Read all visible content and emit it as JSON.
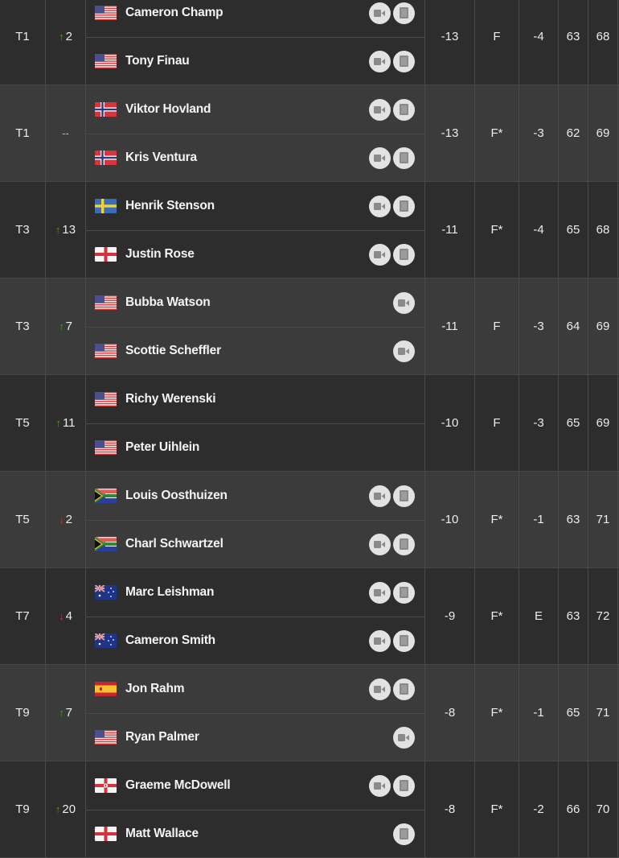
{
  "colors": {
    "row_dark": "#2d2d2d",
    "row_light": "#3b3b3b",
    "move_up": "#4c9a2a",
    "move_down": "#e0322a",
    "icon_bg": "#e2e2e2",
    "icon_glyph": "#8a8a8a"
  },
  "teams": [
    {
      "pos": "T1",
      "move": {
        "dir": "up",
        "value": "2"
      },
      "total": "-13",
      "thru": "F",
      "today": "-4",
      "r1": "63",
      "r2": "68",
      "players": [
        {
          "name": "Cameron Champ",
          "flag": "usa",
          "icons": [
            "video-icon",
            "scorecard-icon"
          ]
        },
        {
          "name": "Tony Finau",
          "flag": "usa",
          "icons": [
            "video-icon",
            "scorecard-icon"
          ]
        }
      ]
    },
    {
      "pos": "T1",
      "move": {
        "dir": "none",
        "value": "--"
      },
      "total": "-13",
      "thru": "F*",
      "today": "-3",
      "r1": "62",
      "r2": "69",
      "players": [
        {
          "name": "Viktor Hovland",
          "flag": "norway",
          "icons": [
            "video-icon",
            "scorecard-icon"
          ]
        },
        {
          "name": "Kris Ventura",
          "flag": "norway",
          "icons": [
            "video-icon",
            "scorecard-icon"
          ]
        }
      ]
    },
    {
      "pos": "T3",
      "move": {
        "dir": "up",
        "value": "13"
      },
      "total": "-11",
      "thru": "F*",
      "today": "-4",
      "r1": "65",
      "r2": "68",
      "players": [
        {
          "name": "Henrik Stenson",
          "flag": "sweden",
          "icons": [
            "video-icon",
            "scorecard-icon"
          ]
        },
        {
          "name": "Justin Rose",
          "flag": "england",
          "icons": [
            "video-icon",
            "scorecard-icon"
          ]
        }
      ]
    },
    {
      "pos": "T3",
      "move": {
        "dir": "up",
        "value": "7"
      },
      "total": "-11",
      "thru": "F",
      "today": "-3",
      "r1": "64",
      "r2": "69",
      "players": [
        {
          "name": "Bubba Watson",
          "flag": "usa",
          "icons": [
            "video-icon"
          ]
        },
        {
          "name": "Scottie Scheffler",
          "flag": "usa",
          "icons": [
            "video-icon"
          ]
        }
      ]
    },
    {
      "pos": "T5",
      "move": {
        "dir": "up",
        "value": "11"
      },
      "total": "-10",
      "thru": "F",
      "today": "-3",
      "r1": "65",
      "r2": "69",
      "players": [
        {
          "name": "Richy Werenski",
          "flag": "usa",
          "icons": []
        },
        {
          "name": "Peter Uihlein",
          "flag": "usa",
          "icons": []
        }
      ]
    },
    {
      "pos": "T5",
      "move": {
        "dir": "down",
        "value": "2"
      },
      "total": "-10",
      "thru": "F*",
      "today": "-1",
      "r1": "63",
      "r2": "71",
      "players": [
        {
          "name": "Louis Oosthuizen",
          "flag": "south-africa",
          "icons": [
            "video-icon",
            "scorecard-icon"
          ]
        },
        {
          "name": "Charl Schwartzel",
          "flag": "south-africa",
          "icons": [
            "video-icon",
            "scorecard-icon"
          ]
        }
      ]
    },
    {
      "pos": "T7",
      "move": {
        "dir": "down",
        "value": "4"
      },
      "total": "-9",
      "thru": "F*",
      "today": "E",
      "r1": "63",
      "r2": "72",
      "players": [
        {
          "name": "Marc Leishman",
          "flag": "australia",
          "icons": [
            "video-icon",
            "scorecard-icon"
          ]
        },
        {
          "name": "Cameron Smith",
          "flag": "australia",
          "icons": [
            "video-icon",
            "scorecard-icon"
          ]
        }
      ]
    },
    {
      "pos": "T9",
      "move": {
        "dir": "up",
        "value": "7"
      },
      "total": "-8",
      "thru": "F*",
      "today": "-1",
      "r1": "65",
      "r2": "71",
      "players": [
        {
          "name": "Jon Rahm",
          "flag": "spain",
          "icons": [
            "video-icon",
            "scorecard-icon"
          ]
        },
        {
          "name": "Ryan Palmer",
          "flag": "usa",
          "icons": [
            "video-icon"
          ]
        }
      ]
    },
    {
      "pos": "T9",
      "move": {
        "dir": "up",
        "value": "20"
      },
      "total": "-8",
      "thru": "F*",
      "today": "-2",
      "r1": "66",
      "r2": "70",
      "players": [
        {
          "name": "Graeme McDowell",
          "flag": "northern-ireland",
          "icons": [
            "video-icon",
            "scorecard-icon"
          ]
        },
        {
          "name": "Matt Wallace",
          "flag": "england",
          "icons": [
            "scorecard-icon"
          ]
        }
      ]
    }
  ]
}
